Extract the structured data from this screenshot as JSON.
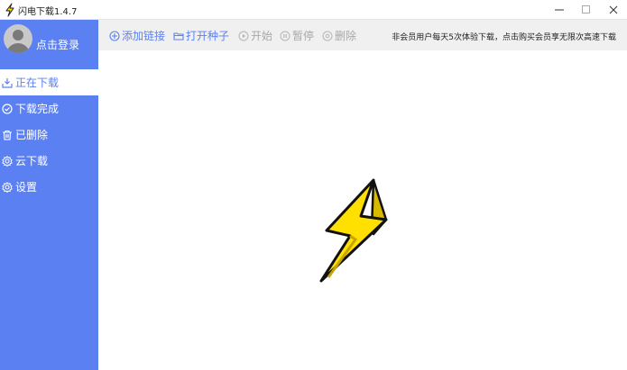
{
  "window": {
    "title": "闪电下载1.4.7"
  },
  "sidebar": {
    "login_label": "点击登录",
    "items": [
      {
        "label": "正在下载",
        "icon": "download-icon",
        "active": true
      },
      {
        "label": "下载完成",
        "icon": "check-circle-icon",
        "active": false
      },
      {
        "label": "已删除",
        "icon": "trash-icon",
        "active": false
      },
      {
        "label": "云下载",
        "icon": "cloud-gear-icon",
        "active": false
      },
      {
        "label": "设置",
        "icon": "gear-icon",
        "active": false
      }
    ]
  },
  "toolbar": {
    "add_link": "添加链接",
    "open_torrent": "打开种子",
    "start": "开始",
    "pause": "暂停",
    "delete": "删除",
    "notice": "非会员用户每天5次体验下载，点击购买会员享无限次高速下载"
  },
  "colors": {
    "accent": "#5b80f1",
    "toolbar_bg": "#f0f0f0",
    "enabled_tool": "#5b80f1",
    "disabled_tool": "#a8a8a8",
    "logo_yellow": "#ffe000"
  }
}
